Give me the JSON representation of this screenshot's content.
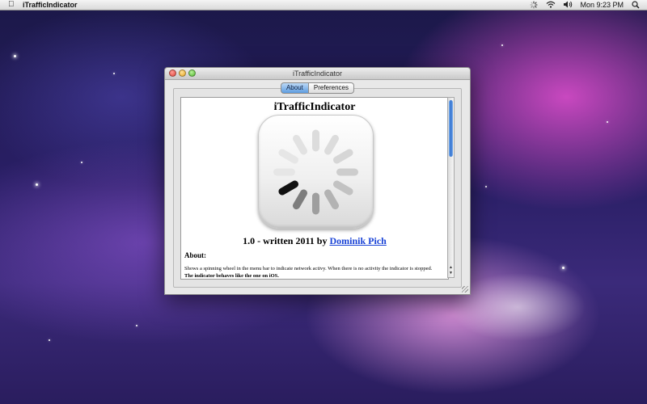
{
  "menubar": {
    "apple_glyph": "",
    "app_name": "iTrafficIndicator",
    "clock": "Mon 9:23 PM",
    "icons": [
      "spinner-icon",
      "wifi-icon",
      "speaker-icon",
      "spotlight-icon"
    ]
  },
  "window": {
    "title": "iTrafficIndicator",
    "tabs": [
      {
        "label": "About",
        "active": true
      },
      {
        "label": "Preferences",
        "active": false
      }
    ]
  },
  "about": {
    "title": "iTrafficIndicator",
    "version_prefix": "1.0 - written 2011 by ",
    "author_link": "Dominik Pich",
    "heading": "About:",
    "description_line1": "Shows a spinning wheel in the menu bar to indicate network activy. When there is no activity the indicator is stopped.",
    "description_line2": "The indicator behaves like the one on iOS."
  },
  "colors": {
    "link": "#1a43d6",
    "tab_active": "#5d9de0"
  }
}
